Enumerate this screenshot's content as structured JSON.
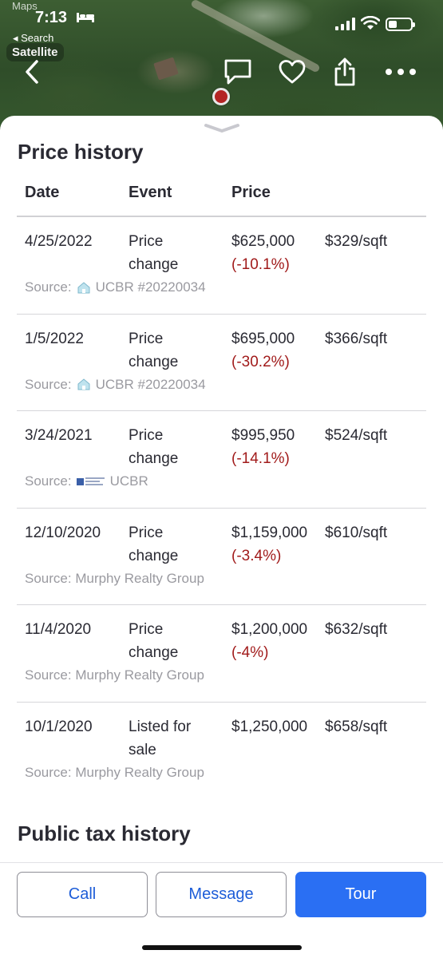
{
  "status_bar": {
    "time": "7:13",
    "back_app": "Maps",
    "back_to": "◂ Search"
  },
  "map": {
    "layer_label": "Satellite"
  },
  "price_history": {
    "title": "Price history",
    "columns": [
      "Date",
      "Event",
      "Price"
    ],
    "rows": [
      {
        "date": "4/25/2022",
        "event": "Price change",
        "price": "$625,000",
        "change": "(-10.1%)",
        "per_sqft": "$329/sqft",
        "source_prefix": "Source:",
        "source": "UCBR #20220034",
        "source_logo": "house-logo"
      },
      {
        "date": "1/5/2022",
        "event": "Price change",
        "price": "$695,000",
        "change": "(-30.2%)",
        "per_sqft": "$366/sqft",
        "source_prefix": "Source:",
        "source": "UCBR #20220034",
        "source_logo": "house-logo"
      },
      {
        "date": "3/24/2021",
        "event": "Price change",
        "price": "$995,950",
        "change": "(-14.1%)",
        "per_sqft": "$524/sqft",
        "source_prefix": "Source:",
        "source": "UCBR",
        "source_logo": "mls-logo"
      },
      {
        "date": "12/10/2020",
        "event": "Price change",
        "price": "$1,159,000",
        "change": "(-3.4%)",
        "per_sqft": "$610/sqft",
        "source_prefix": "Source:",
        "source": "Murphy Realty Group",
        "source_logo": ""
      },
      {
        "date": "11/4/2020",
        "event": "Price change",
        "price": "$1,200,000",
        "change": "(-4%)",
        "per_sqft": "$632/sqft",
        "source_prefix": "Source:",
        "source": "Murphy Realty Group",
        "source_logo": ""
      },
      {
        "date": "10/1/2020",
        "event": "Listed for sale",
        "price": "$1,250,000",
        "change": "",
        "per_sqft": "$658/sqft",
        "source_prefix": "Source:",
        "source": "Murphy Realty Group",
        "source_logo": ""
      }
    ]
  },
  "tax_history": {
    "title": "Public tax history"
  },
  "actions": {
    "call": "Call",
    "message": "Message",
    "tour": "Tour"
  },
  "colors": {
    "accent": "#2a6ff3",
    "link": "#1d5dd8",
    "negative_change": "#a11b1b"
  }
}
